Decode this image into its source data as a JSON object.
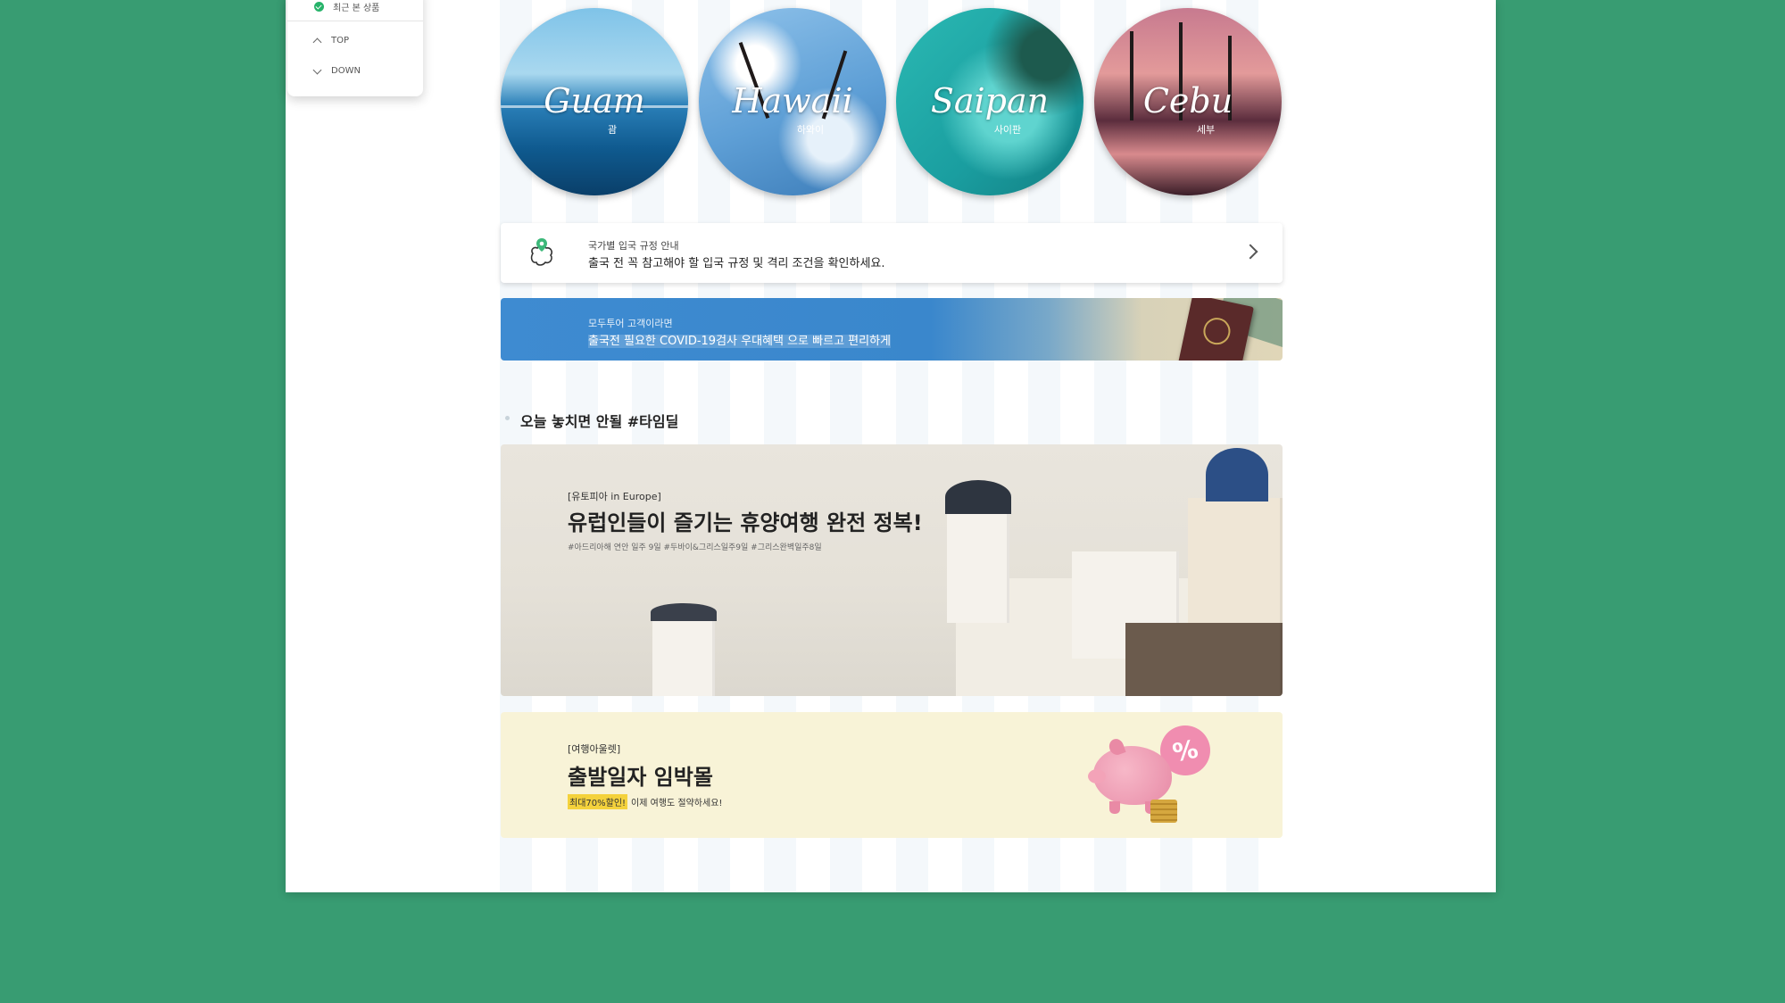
{
  "sidepanel": {
    "recent_label": "최근 본 상품",
    "top_label": "TOP",
    "down_label": "DOWN"
  },
  "destinations": [
    {
      "name_en": "Guam",
      "name_ko": "괌"
    },
    {
      "name_en": "Hawaii",
      "name_ko": "하와이"
    },
    {
      "name_en": "Saipan",
      "name_ko": "사이판"
    },
    {
      "name_en": "Cebu",
      "name_ko": "세부"
    }
  ],
  "entry_info": {
    "small": "국가별 입국 규정 안내",
    "main": "출국 전 꼭 참고해야 할 입국 규정 및 격리 조건을 확인하세요."
  },
  "covid_banner": {
    "small": "모두투어 고객이라면",
    "main": "출국전 필요한 COVID-19검사 우대혜택 으로 빠르고 편리하게"
  },
  "timedeal": {
    "title": "오늘 놓치면 안될 #타임딜"
  },
  "europe_banner": {
    "small": "[유토피아 in Europe]",
    "title": "유럽인들이 즐기는 휴양여행 완전 정복!",
    "tags": "#아드리아해 연안 일주 9일 #두바이&그리스일주9일 #그리스완벽일주8일"
  },
  "outlet_banner": {
    "small": "[여행아울렛]",
    "title": "출발일자 임박몰",
    "highlight": "최대70%할인!",
    "rest": "이제 여행도 절약하세요!",
    "badge": "%"
  },
  "colors": {
    "background": "#389c72",
    "covid_blue": "#3e8bd1",
    "outlet_yellow": "#f8f3d7",
    "highlight_yellow": "#f4d23c"
  }
}
